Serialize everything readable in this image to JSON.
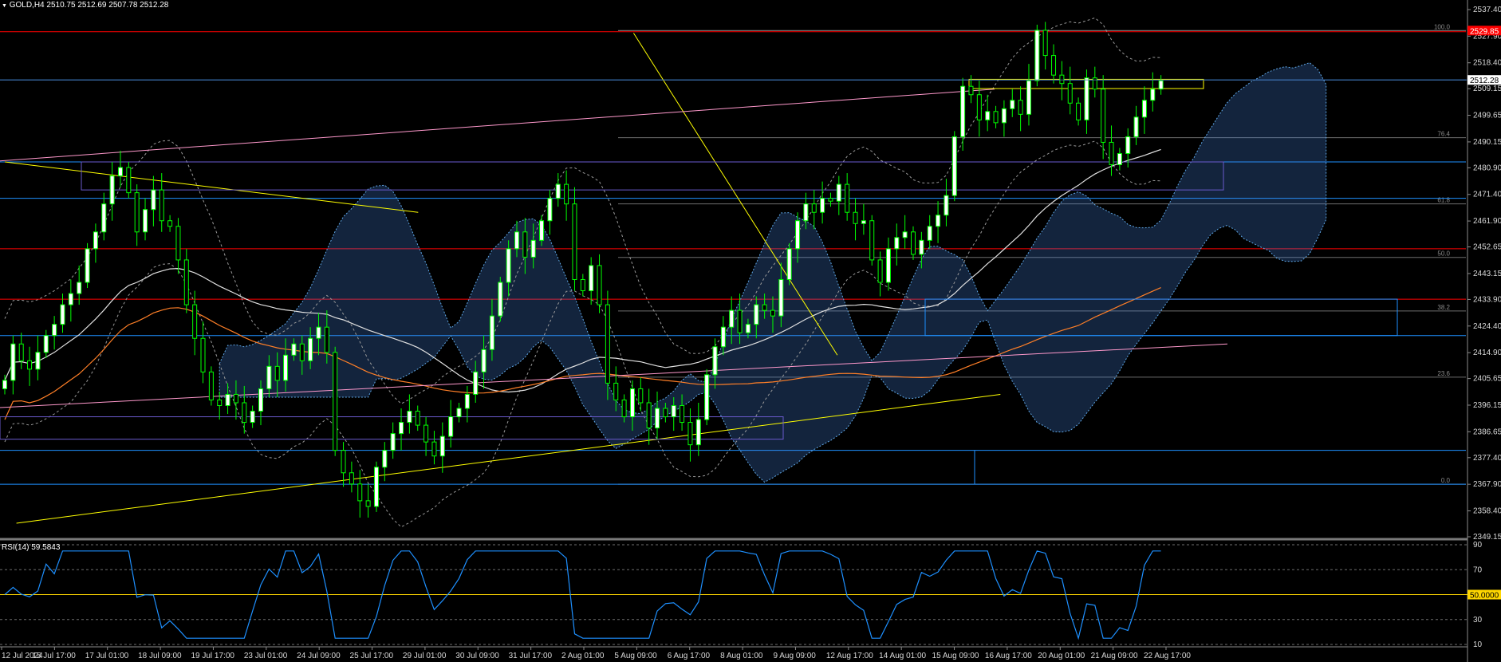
{
  "header": {
    "symbol": "GOLD,H4",
    "ohlc": "2510.75 2512.69 2507.78 2512.28"
  },
  "rsi": {
    "label": "RSI(14) 59.5843",
    "levels": [
      "90",
      "70",
      "50.0000",
      "30",
      "10"
    ]
  },
  "price_axis": {
    "ticks": [
      "2537.40",
      "2527.90",
      "2518.40",
      "2509.15",
      "2499.65",
      "2490.15",
      "2480.90",
      "2471.40",
      "2461.90",
      "2452.65",
      "2443.15",
      "2433.90",
      "2424.40",
      "2414.90",
      "2405.65",
      "2396.15",
      "2386.65",
      "2377.40",
      "2367.90",
      "2358.40",
      "2349.15"
    ],
    "current_price": "2512.28",
    "red_tag": "2529.85"
  },
  "fib_labels": [
    "100.0",
    "76.4",
    "61.8",
    "50.0",
    "38.2",
    "23.6",
    "0.0"
  ],
  "time_axis": [
    "12 Jul 2024",
    "15 Jul 17:00",
    "17 Jul 01:00",
    "18 Jul 09:00",
    "19 Jul 17:00",
    "23 Jul 01:00",
    "24 Jul 09:00",
    "25 Jul 17:00",
    "29 Jul 01:00",
    "30 Jul 09:00",
    "31 Jul 17:00",
    "2 Aug 01:00",
    "5 Aug 09:00",
    "6 Aug 17:00",
    "8 Aug 01:00",
    "9 Aug 09:00",
    "12 Aug 17:00",
    "14 Aug 01:00",
    "15 Aug 09:00",
    "16 Aug 17:00",
    "20 Aug 01:00",
    "21 Aug 09:00",
    "22 Aug 17:00"
  ],
  "colors": {
    "background": "#000000",
    "bull_candle": "#ffffff",
    "candle_edge": "#00ff00",
    "red_line": "#ff0000",
    "hline_blue": "#1e90ff",
    "trendline_yellow": "#ffff00",
    "pink_channel": "#ff99cc",
    "rsi_line": "#1e90ff",
    "rsi_mid": "#ffd700",
    "orange_ma": "#ff7f27",
    "white_ma": "#e0e0e0"
  },
  "chart_data": {
    "type": "candlestick",
    "symbol": "GOLD",
    "timeframe": "H4",
    "ylim": [
      2349.15,
      2537.4
    ],
    "rsi_ylim": [
      10,
      90
    ],
    "trendlines": [
      {
        "color": "yellow",
        "from": [
          2352,
          2354
        ],
        "to": [
          2521,
          2400
        ]
      },
      {
        "color": "yellow",
        "from": [
          2350,
          2483
        ],
        "to": [
          2421,
          2465
        ]
      },
      {
        "color": "yellow",
        "from": [
          2458,
          2529
        ],
        "to": [
          2493,
          2414
        ]
      },
      {
        "color": "pink",
        "from": [
          2320,
          2479
        ],
        "to": [
          2520,
          2509
        ]
      },
      {
        "color": "pink",
        "from": [
          2300,
          2390
        ],
        "to": [
          2560,
          2418
        ]
      }
    ],
    "horizontal_levels": [
      2529.5,
      2512.28,
      2483,
      2470,
      2452,
      2434,
      2421,
      2380,
      2367.9
    ],
    "closes": [
      2405,
      2418,
      2412,
      2409,
      2415,
      2421,
      2425,
      2432,
      2436,
      2440,
      2452,
      2458,
      2468,
      2478,
      2481,
      2472,
      2458,
      2466,
      2473,
      2462,
      2460,
      2448,
      2432,
      2420,
      2408,
      2398,
      2396,
      2400,
      2397,
      2390,
      2394,
      2402,
      2410,
      2405,
      2414,
      2418,
      2412,
      2420,
      2424,
      2415,
      2380,
      2372,
      2368,
      2362,
      2360,
      2374,
      2380,
      2386,
      2390,
      2394,
      2389,
      2383,
      2378,
      2385,
      2392,
      2395,
      2400,
      2408,
      2416,
      2428,
      2440,
      2452,
      2458,
      2449,
      2455,
      2462,
      2470,
      2475,
      2468,
      2441,
      2437,
      2446,
      2432,
      2404,
      2398,
      2392,
      2402,
      2397,
      2388,
      2395,
      2392,
      2396,
      2390,
      2382,
      2391,
      2407,
      2417,
      2424,
      2430,
      2422,
      2425,
      2432,
      2430,
      2428,
      2441,
      2452,
      2462,
      2468,
      2465,
      2470,
      2469,
      2475,
      2465,
      2461,
      2462,
      2448,
      2440,
      2452,
      2456,
      2458,
      2450,
      2455,
      2460,
      2464,
      2471,
      2492,
      2510,
      2507,
      2498,
      2501,
      2497,
      2502,
      2505,
      2500,
      2512,
      2530,
      2521,
      2514,
      2511,
      2504,
      2498,
      2513,
      2509,
      2490,
      2482,
      2486,
      2492,
      2499,
      2505,
      2509,
      2512
    ]
  }
}
